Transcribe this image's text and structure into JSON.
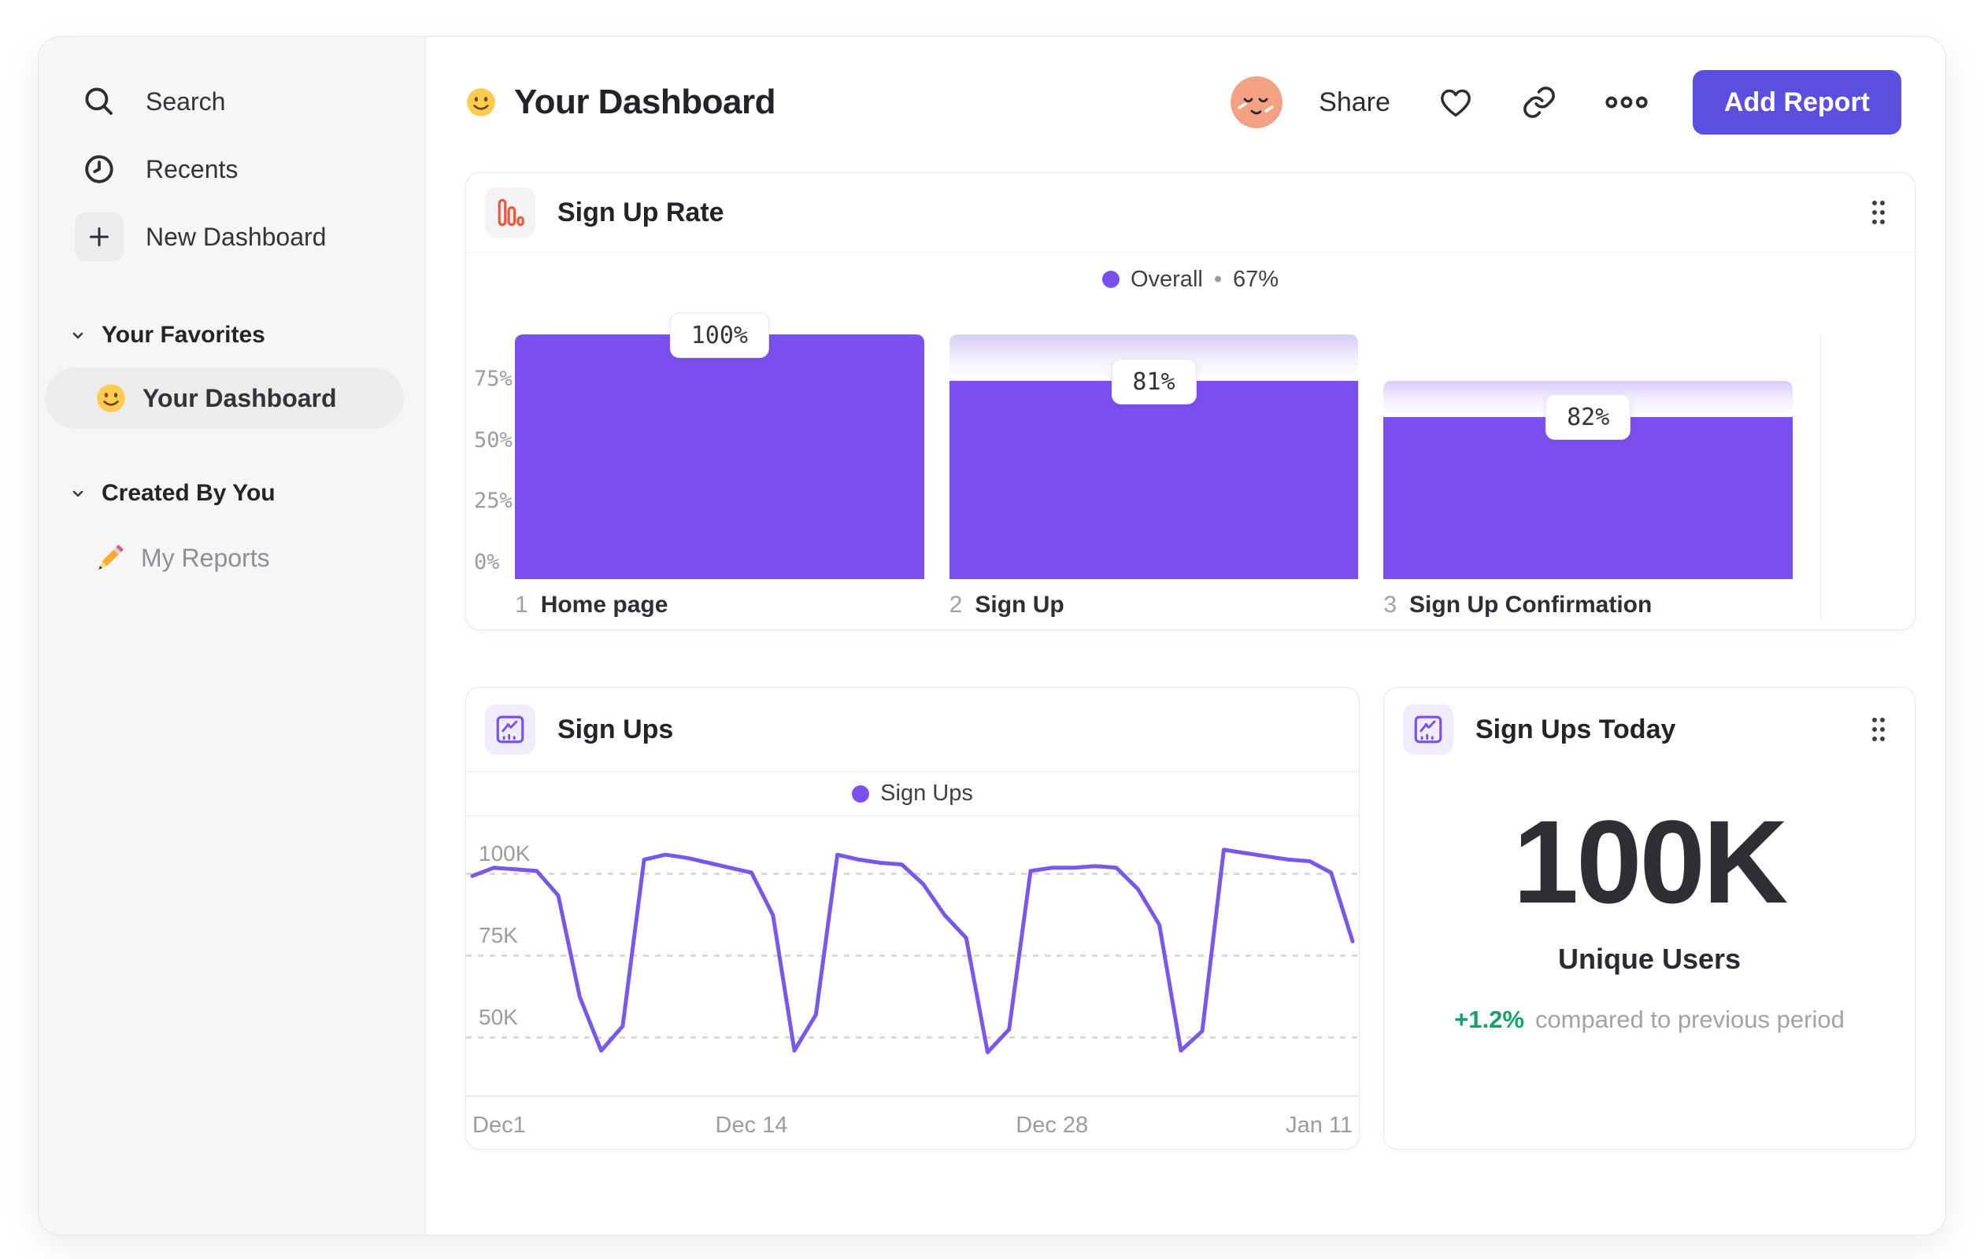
{
  "colors": {
    "accent_purple": "#7c50f0",
    "line_purple": "#7a57eb",
    "button_indigo": "#5b4fe0",
    "funnel_icon_orange": "#f2573c",
    "positive_green": "#16a266",
    "ghost_gradient_top": "#d8ccf8",
    "sidebar_bg": "#f6f6f7",
    "active_item_bg": "#ececec"
  },
  "sidebar": {
    "nav_items": [
      {
        "icon": "search-icon",
        "label": "Search"
      },
      {
        "icon": "clock-icon",
        "label": "Recents"
      },
      {
        "icon": "plus-icon",
        "label": "New Dashboard",
        "boxed": true
      }
    ],
    "sections": [
      {
        "label": "Your Favorites",
        "items": [
          {
            "emoji_icon": "smiley-emoji",
            "label": "Your Dashboard",
            "active": true
          }
        ]
      },
      {
        "label": "Created By You",
        "items": [
          {
            "emoji_icon": "pencil-emoji",
            "label": "My Reports",
            "muted": true
          }
        ]
      }
    ]
  },
  "header": {
    "emoji_icon": "smiley-emoji",
    "title": "Your Dashboard",
    "actions": {
      "share": "Share",
      "add_report": "Add Report"
    }
  },
  "chart_data": [
    {
      "type": "bar",
      "variant": "funnel",
      "title": "Sign Up Rate",
      "legend": {
        "label": "Overall",
        "separator": "•",
        "value": "67%"
      },
      "categories": [
        "Home page",
        "Sign Up",
        "Sign Up Confirmation"
      ],
      "step_numbers": [
        "1",
        "2",
        "3"
      ],
      "values_pct": [
        100,
        81,
        82
      ],
      "cumulative_pct": [
        100,
        81,
        66.4
      ],
      "value_labels": [
        "100%",
        "81%",
        "82%"
      ],
      "y_ticks": [
        "75%",
        "50%",
        "25%",
        "0%"
      ],
      "y_tick_values": [
        75,
        50,
        25,
        0
      ],
      "ylim": [
        0,
        100
      ],
      "grid": false,
      "legend_position": "top-center"
    },
    {
      "type": "line",
      "title": "Sign Ups",
      "legend_label": "Sign Ups",
      "x_ticks": [
        "Dec1",
        "Dec 14",
        "Dec 28",
        "Jan 11"
      ],
      "x_tick_days": [
        0,
        13,
        27,
        41
      ],
      "y_ticks": [
        "100K",
        "75K",
        "50K"
      ],
      "y_tick_values": [
        100,
        75,
        50
      ],
      "ylim_k": [
        30,
        112
      ],
      "grid": "dotted-horizontal",
      "legend_position": "top-center",
      "series": [
        {
          "name": "Sign Ups",
          "unit": "K",
          "x_days": [
            0,
            1,
            2,
            3,
            4,
            5,
            6,
            7,
            8,
            9,
            10,
            11,
            12,
            13,
            14,
            15,
            16,
            17,
            18,
            19,
            20,
            21,
            22,
            23,
            24,
            25,
            26,
            27,
            28,
            29,
            30,
            31,
            32,
            33,
            34,
            35,
            36,
            37,
            38,
            39,
            40,
            41
          ],
          "values_k": [
            99,
            101.5,
            101,
            100.5,
            93,
            62,
            45.5,
            53,
            104,
            105.5,
            104.5,
            103,
            101.5,
            100,
            87,
            45.5,
            56.5,
            105.5,
            104,
            103,
            102.5,
            96.5,
            87,
            80,
            45,
            52,
            100.5,
            101.5,
            101.5,
            102,
            101.5,
            95,
            84,
            45.5,
            51.5,
            107,
            106,
            105,
            104,
            103.5,
            100,
            79
          ]
        }
      ]
    },
    {
      "type": "big-number",
      "title": "Sign Ups Today",
      "value": "100K",
      "label": "Unique Users",
      "delta": "+1.2%",
      "delta_direction": "up",
      "delta_note": "compared to previous period"
    }
  ]
}
